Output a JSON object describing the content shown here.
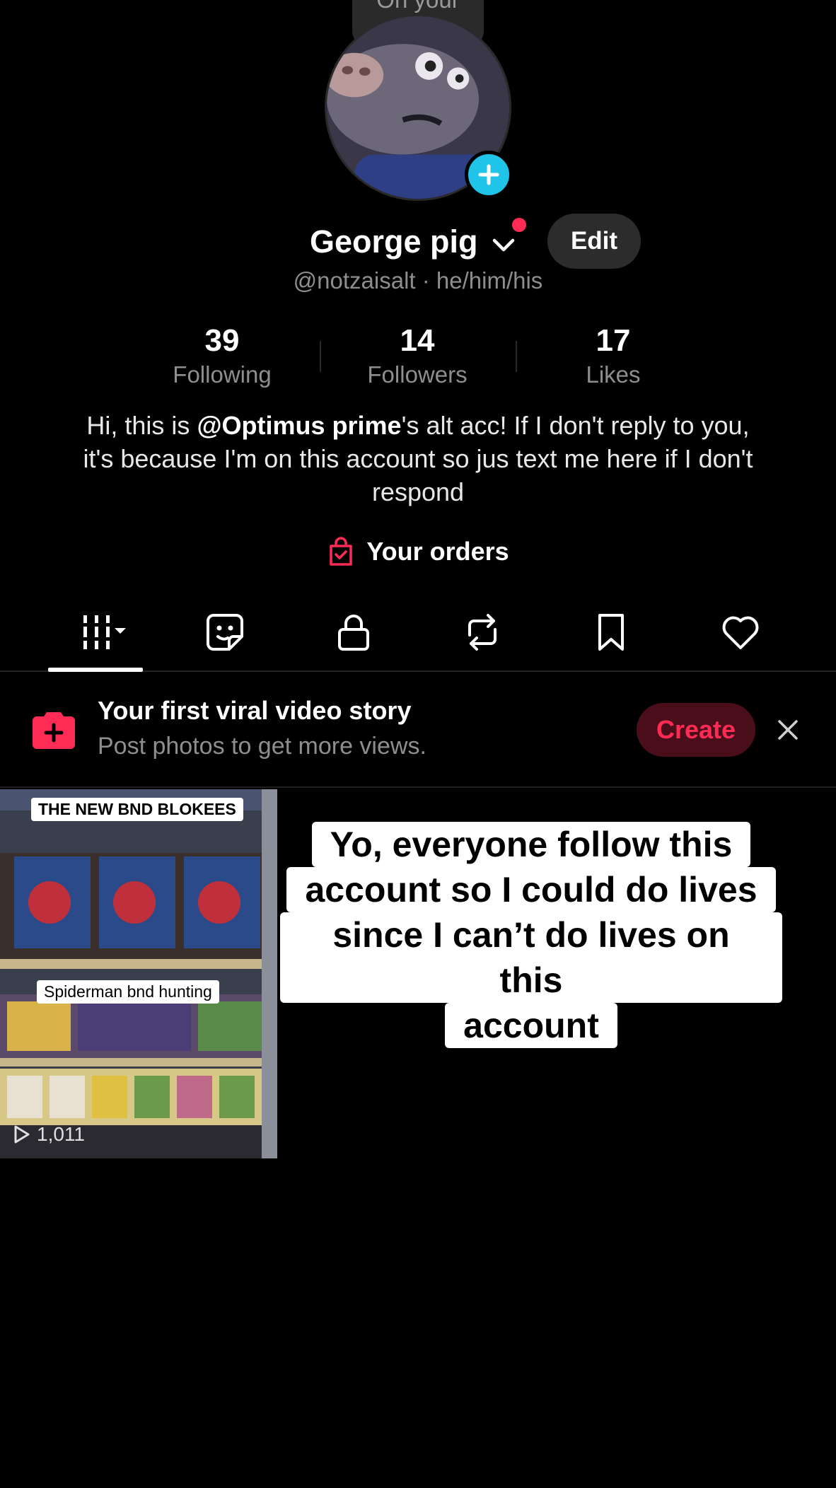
{
  "profile": {
    "bubble_text": "On your\nmind...",
    "name": "George pig",
    "edit_label": "Edit",
    "handle_line": "@notzaisalt · he/him/his"
  },
  "stats": [
    {
      "value": "39",
      "label": "Following"
    },
    {
      "value": "14",
      "label": "Followers"
    },
    {
      "value": "17",
      "label": "Likes"
    }
  ],
  "bio": {
    "prefix": "Hi, this is ",
    "mention": "@Optimus prime",
    "suffix": "'s alt acc! If I don't reply to you, it's because I'm on this account so jus text me here if I don't respond"
  },
  "orders_label": "Your orders",
  "tabs": [
    {
      "icon": "grid-videos-icon",
      "active": true
    },
    {
      "icon": "sticker-icon"
    },
    {
      "icon": "lock-icon"
    },
    {
      "icon": "repost-icon"
    },
    {
      "icon": "bookmark-icon"
    },
    {
      "icon": "heart-icon"
    }
  ],
  "promo": {
    "title": "Your first viral video story",
    "subtitle": "Post photos to get more views.",
    "create_label": "Create"
  },
  "videos": [
    {
      "label_top": "THE NEW BND BLOKEES",
      "label_mid": "Spiderman bnd hunting",
      "views": "1,011"
    }
  ],
  "caption_lines": [
    "Yo, everyone follow this",
    "account so I could do lives",
    "since I can’t do lives on this",
    "account"
  ],
  "colors": {
    "accent_red": "#fe2c55",
    "add_blue": "#20c4e8",
    "background": "#000000",
    "muted_text": "#8e8e8e"
  }
}
